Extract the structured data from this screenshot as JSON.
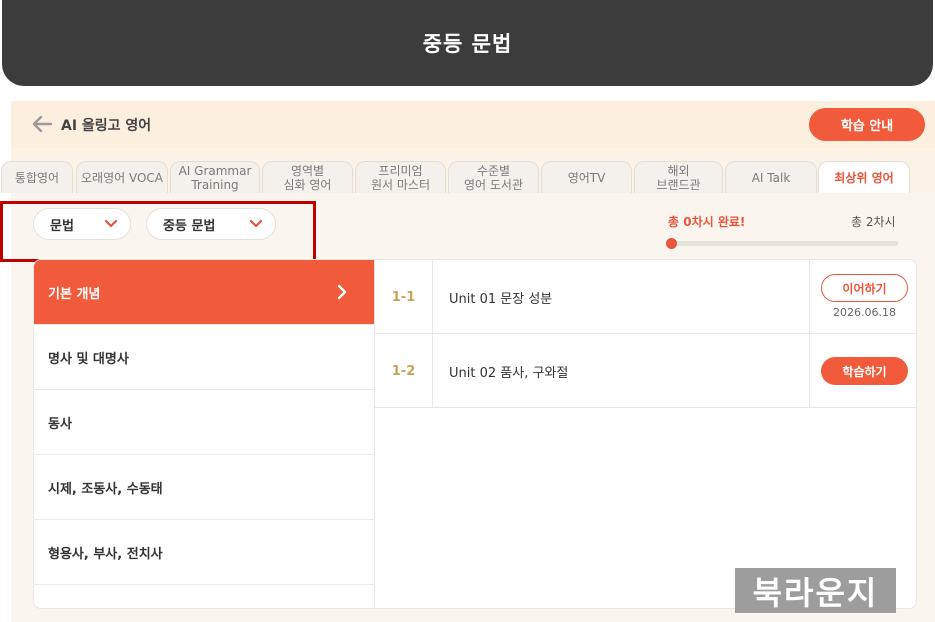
{
  "banner": {
    "title": "중등 문법"
  },
  "header": {
    "back_icon": "arrow-left-icon",
    "title": "AI 올링고 영어",
    "guide_button": "학습 안내"
  },
  "tabs": [
    {
      "line1": "통합영어",
      "line2": ""
    },
    {
      "line1": "오래영어 VOCA",
      "line2": ""
    },
    {
      "line1": "AI Grammar",
      "line2": "Training"
    },
    {
      "line1": "영역별",
      "line2": "심화 영어"
    },
    {
      "line1": "프리미엄",
      "line2": "원서 마스터"
    },
    {
      "line1": "수준별",
      "line2": "영어 도서관"
    },
    {
      "line1": "영어TV",
      "line2": ""
    },
    {
      "line1": "해외",
      "line2": "브랜드관"
    },
    {
      "line1": "AI Talk",
      "line2": ""
    },
    {
      "line1": "최상위 영어",
      "line2": "",
      "active": true
    }
  ],
  "filters": {
    "subject": "문법",
    "level": "중등 문법",
    "chevron_icon": "chevron-down-icon"
  },
  "progress": {
    "completed_text": "총 0차시 완료!",
    "total_text": "총 2차시",
    "completed": 0,
    "total": 2
  },
  "categories": [
    {
      "label": "기본 개념",
      "active": true
    },
    {
      "label": "명사 및 대명사"
    },
    {
      "label": "동사"
    },
    {
      "label": "시제, 조동사, 수동태"
    },
    {
      "label": "형용사, 부사, 전치사"
    }
  ],
  "units": [
    {
      "num": "1-1",
      "title": "Unit 01 문장 성분",
      "action": "이어하기",
      "date": "2026.06.18"
    },
    {
      "num": "1-2",
      "title": "Unit 02 품사, 구와절",
      "action": "학습하기",
      "date": ""
    }
  ],
  "watermark": "북라운지",
  "colors": {
    "accent": "#f15a3a",
    "banner": "#3c3c3c",
    "highlight": "#c00000"
  }
}
